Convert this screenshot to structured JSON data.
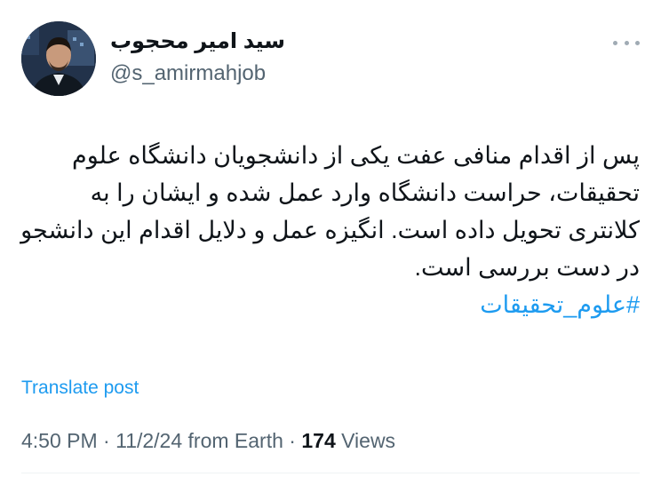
{
  "author": {
    "display_name": "سید امیر محجوب",
    "handle": "@s_amirmahjob",
    "avatar_icon": "profile-photo"
  },
  "post": {
    "text": "پس از اقدام منافی عفت یکی از دانشجویان دانشگاه علوم تحقیقات، حراست دانشگاه وارد عمل شده و ایشان را به کلانتری تحویل داده است. انگیزه عمل و دلایل اقدام این دانشجو در دست بررسی است.",
    "hashtag": "#علوم_تحقیقات",
    "translate_label": "Translate post"
  },
  "meta": {
    "time": "4:50 PM",
    "date": "11/2/24",
    "source": "from Earth",
    "separator": "·",
    "views_count": "174",
    "views_label": "Views"
  },
  "colors": {
    "link": "#1d9bf0",
    "secondary_text": "#536471",
    "primary_text": "#0f1419"
  }
}
